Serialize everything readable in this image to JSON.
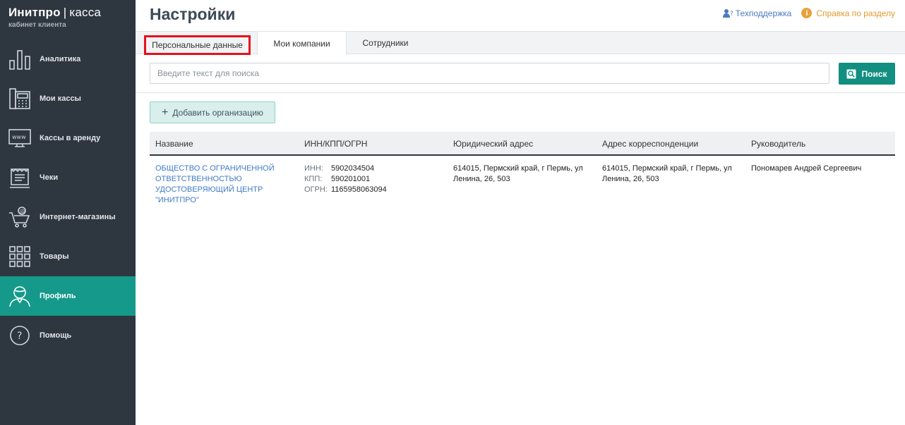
{
  "sidebar": {
    "logo": {
      "brand": "Инитпро",
      "separator": "|",
      "product": "касса",
      "subtitle": "кабинет клиента"
    },
    "items": [
      {
        "label": "Аналитика",
        "icon": "bar-chart-icon",
        "active": false
      },
      {
        "label": "Мои кассы",
        "icon": "cash-register-icon",
        "active": false
      },
      {
        "label": "Кассы в аренду",
        "icon": "www-monitor-icon",
        "active": false
      },
      {
        "label": "Чеки",
        "icon": "receipt-icon",
        "active": false
      },
      {
        "label": "Интернет-магазины",
        "icon": "online-cart-icon",
        "active": false
      },
      {
        "label": "Товары",
        "icon": "grid-icon",
        "active": false
      },
      {
        "label": "Профиль",
        "icon": "user-profile-icon",
        "active": true
      },
      {
        "label": "Помощь",
        "icon": "question-icon",
        "active": false
      }
    ]
  },
  "header": {
    "title": "Настройки",
    "support_label": "Техподдержка",
    "help_label": "Справка по разделу"
  },
  "tabs": [
    {
      "label": "Персональные данные",
      "active": false,
      "highlighted": true
    },
    {
      "label": "Мои компании",
      "active": true
    },
    {
      "label": "Сотрудники",
      "active": false
    }
  ],
  "search": {
    "placeholder": "Введите текст для поиска",
    "value": "",
    "button_label": "Поиск"
  },
  "add_button_label": "Добавить организацию",
  "table": {
    "columns": [
      "Название",
      "ИНН/КПП/ОГРН",
      "Юридический адрес",
      "Адрес корреспонденции",
      "Руководитель"
    ],
    "rows": [
      {
        "name": "ОБЩЕСТВО С ОГРАНИЧЕННОЙ ОТВЕТСТВЕННОСТЬЮ УДОСТОВЕРЯЮЩИЙ ЦЕНТР \"ИНИТПРО\"",
        "inn_label": "ИНН:",
        "inn": "5902034504",
        "kpp_label": "КПП:",
        "kpp": "590201001",
        "ogrn_label": "ОГРН:",
        "ogrn": "1165958063094",
        "legal_address": "614015, Пермский край, г Пермь, ул Ленина, 26, 503",
        "mail_address": "614015, Пермский край, г Пермь, ул Ленина, 26, 503",
        "director": "Пономарев Андрей Сергеевич"
      }
    ]
  },
  "colors": {
    "sidebar_bg": "#2e3640",
    "accent": "#14998a",
    "link": "#3f7bc5",
    "help": "#e19a2e",
    "highlight_border": "#e8101c"
  }
}
